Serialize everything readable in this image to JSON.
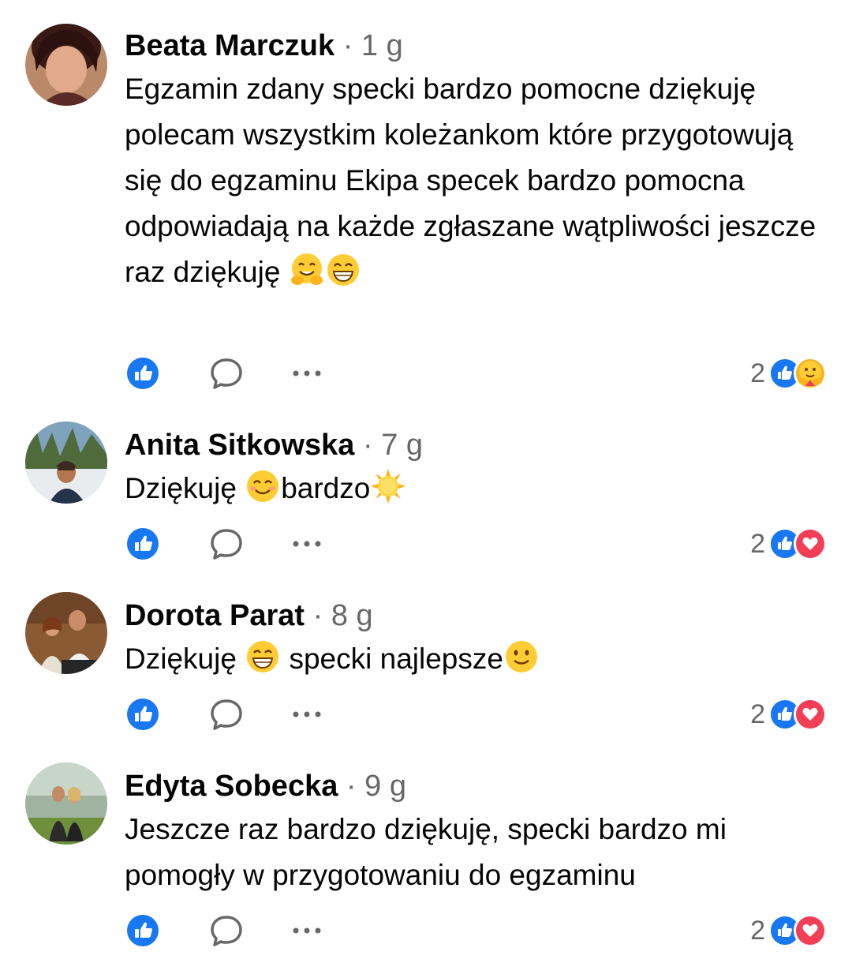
{
  "comments": [
    {
      "author": "Beata Marczuk",
      "separator": "·",
      "time": "1 g",
      "text_before": "Egzamin zdany specki bardzo pomocne dziękuję polecam wszystkim koleżankom które przygotowują się do egzaminu Ekipa specek bardzo pomocna odpowiadają na każde zgłaszane wątpliwości jeszcze raz dziękuję ",
      "text_after": "",
      "emoji": [
        "hugging-face",
        "grinning-face"
      ],
      "reaction_count": "2",
      "reactions": [
        "like",
        "care"
      ]
    },
    {
      "author": "Anita Sitkowska",
      "separator": "·",
      "time": "7 g",
      "text_before": "Dziękuję ",
      "text_middle": "bardzo",
      "emoji": [
        "smiling-face",
        "sun"
      ],
      "reaction_count": "2",
      "reactions": [
        "like",
        "love"
      ]
    },
    {
      "author": "Dorota Parat",
      "separator": "·",
      "time": "8 g",
      "text_before": "Dziękuję ",
      "text_middle": " specki najlepsze",
      "emoji": [
        "grinning-face",
        "slightly-smiling-face"
      ],
      "reaction_count": "2",
      "reactions": [
        "like",
        "love"
      ]
    },
    {
      "author": "Edyta Sobecka",
      "separator": "·",
      "time": "9 g",
      "text_before": "Jeszcze raz bardzo dziękuję, specki bardzo mi pomogły w przygotowaniu do egzaminu",
      "reaction_count": "2",
      "reactions": [
        "like",
        "love"
      ]
    }
  ],
  "icons": {
    "like_action": "thumbs-up-icon",
    "reply_action": "speech-bubble-icon",
    "more_action": "ellipsis-icon"
  },
  "colors": {
    "like_blue": "#1877f2",
    "love_red": "#f33e58",
    "muted_gray": "#65676b",
    "text": "#050505"
  }
}
